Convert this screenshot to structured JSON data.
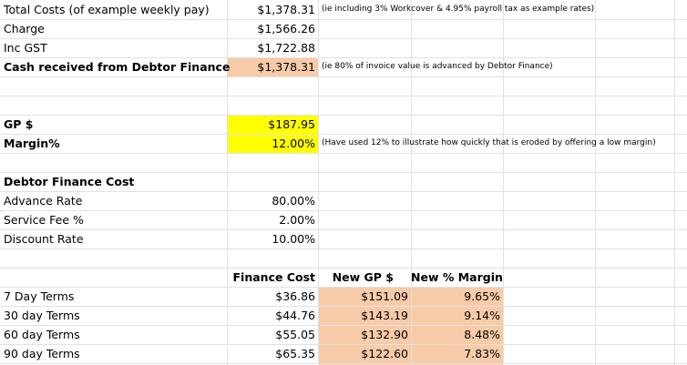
{
  "colors": {
    "peach": "#f8cba8",
    "yellow": "#ffff00",
    "grid": "#e2e2e2"
  },
  "rows": {
    "total_costs": {
      "label": "Total Costs (of example weekly pay)",
      "value": "$1,378.31",
      "note": "(ie including 3% Workcover & 4.95% payroll tax as example rates)"
    },
    "charge": {
      "label": "Charge",
      "value": "$1,566.26"
    },
    "inc_gst": {
      "label": "Inc GST",
      "value": "$1,722.88"
    },
    "cash_received": {
      "label": "Cash received from Debtor Finance",
      "value": "$1,378.31",
      "note": "(ie 80% of invoice value is advanced by Debtor Finance)"
    },
    "gp": {
      "label": "GP $",
      "value": "$187.95"
    },
    "margin": {
      "label": "Margin%",
      "value": "12.00%",
      "note": "(Have used 12% to illustrate how quickly that is eroded by offering a low margin)"
    },
    "df_cost_title": {
      "label": "Debtor Finance Cost"
    },
    "advance_rate": {
      "label": "Advance Rate",
      "value": "80.00%"
    },
    "service_fee": {
      "label": "Service Fee %",
      "value": "2.00%"
    },
    "discount_rate": {
      "label": "Discount Rate",
      "value": "10.00%"
    }
  },
  "terms_table": {
    "headers": {
      "finance_cost": "Finance Cost",
      "new_gp": "New GP $",
      "new_margin": "New % Margin"
    },
    "rows": [
      {
        "label": "7 Day Terms",
        "finance_cost": "$36.86",
        "new_gp": "$151.09",
        "new_margin": "9.65%"
      },
      {
        "label": "30 day Terms",
        "finance_cost": "$44.76",
        "new_gp": "$143.19",
        "new_margin": "9.14%"
      },
      {
        "label": "60 day Terms",
        "finance_cost": "$55.05",
        "new_gp": "$132.90",
        "new_margin": "8.48%"
      },
      {
        "label": "90 day Terms",
        "finance_cost": "$65.35",
        "new_gp": "$122.60",
        "new_margin": "7.83%"
      }
    ]
  }
}
